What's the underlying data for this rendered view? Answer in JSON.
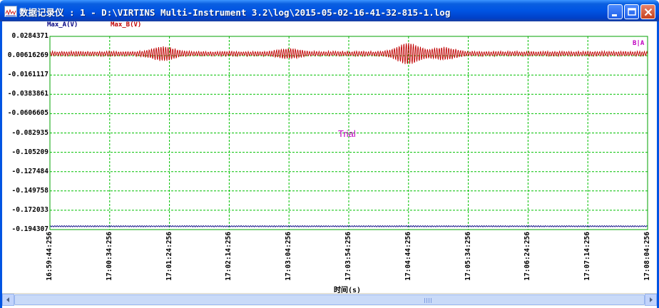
{
  "window": {
    "title": "数据记录仪 : 1 - D:\\VIRTINS Multi-Instrument 3.2\\log\\2015-05-02-16-41-32-815-1.log",
    "icon": "chart-window-icon",
    "controls": [
      "minimize-icon",
      "maximize-icon",
      "close-icon"
    ]
  },
  "legend": [
    {
      "label": "Max_A(V)",
      "color": "#000080"
    },
    {
      "label": "Max_B(V)",
      "color": "#c00000"
    }
  ],
  "watermark": "Trial",
  "corner_label": "B|A",
  "colors": {
    "grid": "#00c000",
    "plot_border": "#00a000",
    "title_bar": "#0054e3",
    "channel_a": "#000080",
    "channel_b": "#c00000"
  },
  "chart_data": {
    "type": "line",
    "xlabel": "时间(s)",
    "ylabel": "",
    "y_ticks": [
      "0.0284371",
      "0.00616269",
      "-0.0161117",
      "-0.0383861",
      "-0.0606605",
      "-0.082935",
      "-0.105209",
      "-0.127484",
      "-0.149758",
      "-0.172033",
      "-0.194307"
    ],
    "ylim": [
      -0.194307,
      0.0284371
    ],
    "x_ticks": [
      "16:59:44:256",
      "17:00:34:256",
      "17:01:24:256",
      "17:02:14:256",
      "17:03:04:256",
      "17:03:54:256",
      "17:04:44:256",
      "17:05:34:256",
      "17:06:24:256",
      "17:07:14:256",
      "17:08:04:256"
    ],
    "xlim": [
      "16:59:44:256",
      "17:08:04:256"
    ],
    "grid": true,
    "series": [
      {
        "name": "Max_B(V)",
        "color": "#c00000",
        "baseline": 0.0085,
        "ripple_amplitude": 0.003,
        "bursts": [
          {
            "center": "17:01:19",
            "amplitude": 0.006
          },
          {
            "center": "17:03:04",
            "amplitude": 0.0035
          },
          {
            "center": "17:04:44",
            "amplitude": 0.01
          },
          {
            "center": "17:05:14",
            "amplitude": 0.005
          }
        ]
      },
      {
        "name": "Max_A(V)",
        "color": "#000080",
        "baseline": -0.1905,
        "ripple_amplitude": 0.0008
      }
    ]
  },
  "scrollbar": {
    "left_arrow": "scroll-left-icon",
    "right_arrow": "scroll-right-icon"
  }
}
